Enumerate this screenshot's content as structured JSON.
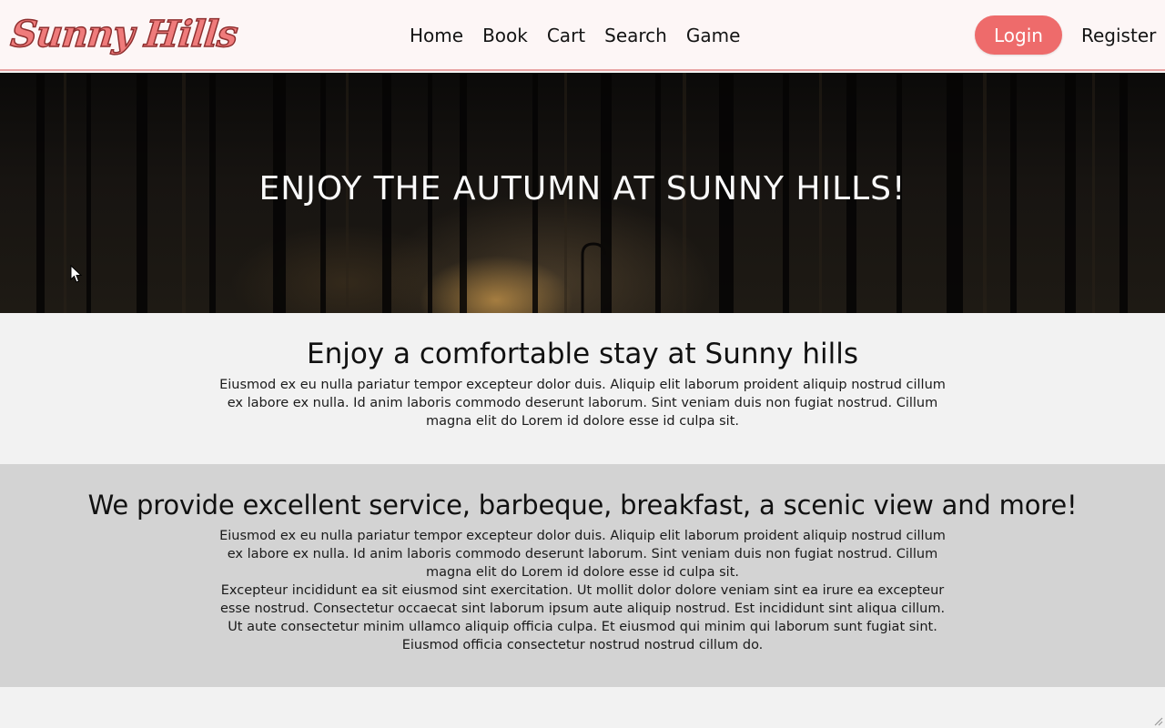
{
  "brand": {
    "logo_text": "Sunny Hills"
  },
  "nav": {
    "links": [
      "Home",
      "Book",
      "Cart",
      "Search",
      "Game"
    ],
    "login_label": "Login",
    "register_label": "Register"
  },
  "hero": {
    "title": "ENJOY THE AUTUMN AT SUNNY HILLS!"
  },
  "sections": [
    {
      "heading": "Enjoy a comfortable stay at Sunny hills",
      "paragraphs": [
        "Eiusmod ex eu nulla pariatur tempor excepteur dolor duis. Aliquip elit laborum proident aliquip nostrud cillum ex labore ex nulla. Id anim laboris commodo deserunt laborum. Sint veniam duis non fugiat nostrud. Cillum magna elit do Lorem id dolore esse id culpa sit."
      ]
    },
    {
      "heading": "We provide excellent service, barbeque, breakfast, a scenic view and more!",
      "paragraphs": [
        "Eiusmod ex eu nulla pariatur tempor excepteur dolor duis. Aliquip elit laborum proident aliquip nostrud cillum ex labore ex nulla. Id anim laboris commodo deserunt laborum. Sint veniam duis non fugiat nostrud. Cillum magna elit do Lorem id dolore esse id culpa sit.",
        "Excepteur incididunt ea sit eiusmod sint exercitation. Ut mollit dolor dolore veniam sint ea irure ea excepteur esse nostrud. Consectetur occaecat sint laborum ipsum aute aliquip nostrud. Est incididunt sint aliqua cillum. Ut aute consectetur minim ullamco aliquip officia culpa. Et eiusmod qui minim qui laborum sunt fugiat sint. Eiusmod officia consectetur nostrud nostrud cillum do."
      ]
    }
  ],
  "colors": {
    "accent": "#ee6b6b",
    "logo_fill": "#ef7b7b",
    "logo_outline": "#8e2f2f",
    "navbar_bg": "#fdf6f6",
    "section_light": "#f2f2f2",
    "section_dark": "#d3d3d3"
  },
  "icons": {
    "cursor": "mouse-pointer-icon",
    "resize": "resize-grip-icon"
  }
}
